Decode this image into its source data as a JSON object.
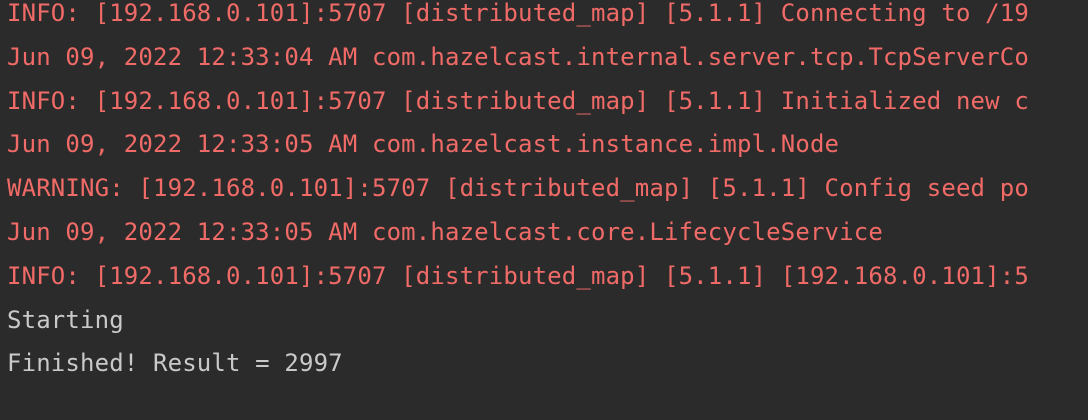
{
  "console": {
    "colors": {
      "background": "#2b2b2b",
      "error_text": "#f06b67",
      "stdout_text": "#c9c9c9"
    },
    "lines": [
      {
        "text": "INFO: [192.168.0.101]:5707 [distributed_map] [5.1.1] Connecting to /19",
        "stream": "stderr"
      },
      {
        "text": "Jun 09, 2022 12:33:04 AM com.hazelcast.internal.server.tcp.TcpServerCo",
        "stream": "stderr"
      },
      {
        "text": "INFO: [192.168.0.101]:5707 [distributed_map] [5.1.1] Initialized new c",
        "stream": "stderr"
      },
      {
        "text": "Jun 09, 2022 12:33:05 AM com.hazelcast.instance.impl.Node",
        "stream": "stderr"
      },
      {
        "text": "WARNING: [192.168.0.101]:5707 [distributed_map] [5.1.1] Config seed po",
        "stream": "stderr"
      },
      {
        "text": "Jun 09, 2022 12:33:05 AM com.hazelcast.core.LifecycleService",
        "stream": "stderr"
      },
      {
        "text": "INFO: [192.168.0.101]:5707 [distributed_map] [5.1.1] [192.168.0.101]:5",
        "stream": "stderr"
      },
      {
        "text": "Starting",
        "stream": "stdout"
      },
      {
        "text": "Finished! Result = 2997",
        "stream": "stdout"
      }
    ]
  }
}
